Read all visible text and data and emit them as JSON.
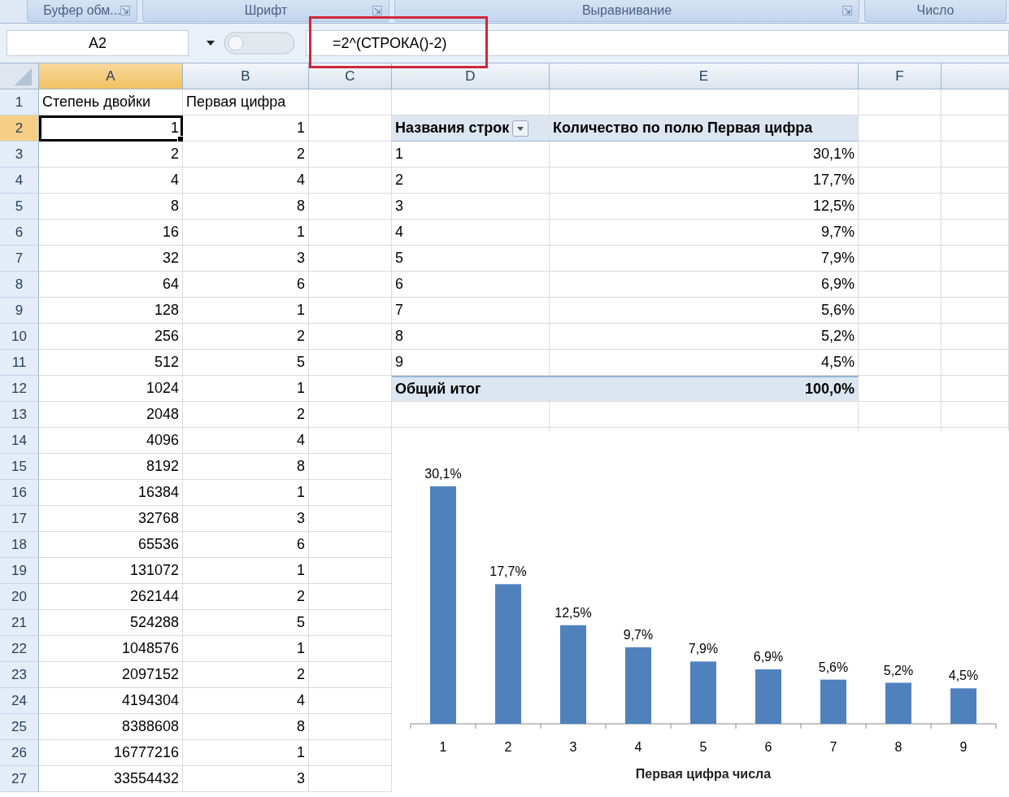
{
  "ribbon_groups": [
    {
      "label": "Буфер обм...",
      "launcher": true
    },
    {
      "label": "Шрифт",
      "launcher": true
    },
    {
      "label": "Выравнивание",
      "launcher": true
    },
    {
      "label": "Число",
      "launcher": false
    }
  ],
  "formula_bar": {
    "name_box": "A2",
    "formula": "=2^(СТРОКА()-2)"
  },
  "columns": [
    {
      "label": "A",
      "selected": true
    },
    {
      "label": "B",
      "selected": false
    },
    {
      "label": "C",
      "selected": false
    },
    {
      "label": "D",
      "selected": false
    },
    {
      "label": "E",
      "selected": false
    },
    {
      "label": "F",
      "selected": false
    }
  ],
  "rows": [
    {
      "number": "1",
      "selected": false,
      "a": "Степень двойки",
      "b": "Первая цифра"
    },
    {
      "number": "2",
      "selected": true,
      "a": "1",
      "b": "1"
    },
    {
      "number": "3",
      "selected": false,
      "a": "2",
      "b": "2"
    },
    {
      "number": "4",
      "selected": false,
      "a": "4",
      "b": "4"
    },
    {
      "number": "5",
      "selected": false,
      "a": "8",
      "b": "8"
    },
    {
      "number": "6",
      "selected": false,
      "a": "16",
      "b": "1"
    },
    {
      "number": "7",
      "selected": false,
      "a": "32",
      "b": "3"
    },
    {
      "number": "8",
      "selected": false,
      "a": "64",
      "b": "6"
    },
    {
      "number": "9",
      "selected": false,
      "a": "128",
      "b": "1"
    },
    {
      "number": "10",
      "selected": false,
      "a": "256",
      "b": "2"
    },
    {
      "number": "11",
      "selected": false,
      "a": "512",
      "b": "5"
    },
    {
      "number": "12",
      "selected": false,
      "a": "1024",
      "b": "1"
    },
    {
      "number": "13",
      "selected": false,
      "a": "2048",
      "b": "2"
    },
    {
      "number": "14",
      "selected": false,
      "a": "4096",
      "b": "4"
    },
    {
      "number": "15",
      "selected": false,
      "a": "8192",
      "b": "8"
    },
    {
      "number": "16",
      "selected": false,
      "a": "16384",
      "b": "1"
    },
    {
      "number": "17",
      "selected": false,
      "a": "32768",
      "b": "3"
    },
    {
      "number": "18",
      "selected": false,
      "a": "65536",
      "b": "6"
    },
    {
      "number": "19",
      "selected": false,
      "a": "131072",
      "b": "1"
    },
    {
      "number": "20",
      "selected": false,
      "a": "262144",
      "b": "2"
    },
    {
      "number": "21",
      "selected": false,
      "a": "524288",
      "b": "5"
    },
    {
      "number": "22",
      "selected": false,
      "a": "1048576",
      "b": "1"
    },
    {
      "number": "23",
      "selected": false,
      "a": "2097152",
      "b": "2"
    },
    {
      "number": "24",
      "selected": false,
      "a": "4194304",
      "b": "4"
    },
    {
      "number": "25",
      "selected": false,
      "a": "8388608",
      "b": "8"
    },
    {
      "number": "26",
      "selected": false,
      "a": "16777216",
      "b": "1"
    },
    {
      "number": "27",
      "selected": false,
      "a": "33554432",
      "b": "3"
    }
  ],
  "pivot": {
    "header": {
      "row_labels": "Названия строк",
      "values": "Количество по полю Первая цифра"
    },
    "rows": [
      {
        "label": "1",
        "value": "30,1%"
      },
      {
        "label": "2",
        "value": "17,7%"
      },
      {
        "label": "3",
        "value": "12,5%"
      },
      {
        "label": "4",
        "value": "9,7%"
      },
      {
        "label": "5",
        "value": "7,9%"
      },
      {
        "label": "6",
        "value": "6,9%"
      },
      {
        "label": "7",
        "value": "5,6%"
      },
      {
        "label": "8",
        "value": "5,2%"
      },
      {
        "label": "9",
        "value": "4,5%"
      }
    ],
    "total": {
      "label": "Общий итог",
      "value": "100,0%"
    }
  },
  "chart": {
    "chart_data": {
      "type": "bar",
      "xlabel": "Первая цифра числа",
      "categories": [
        "1",
        "2",
        "3",
        "4",
        "5",
        "6",
        "7",
        "8",
        "9"
      ],
      "series": [
        {
          "color": "#4f81bd",
          "values": [
            30.1,
            17.7,
            12.5,
            9.7,
            7.9,
            6.9,
            5.6,
            5.2,
            4.5
          ],
          "value_labels": [
            "30,1%",
            "17,7%",
            "12,5%",
            "9,7%",
            "7,9%",
            "6,9%",
            "5,6%",
            "5,2%",
            "4,5%"
          ]
        }
      ],
      "data_labels": true
    }
  }
}
